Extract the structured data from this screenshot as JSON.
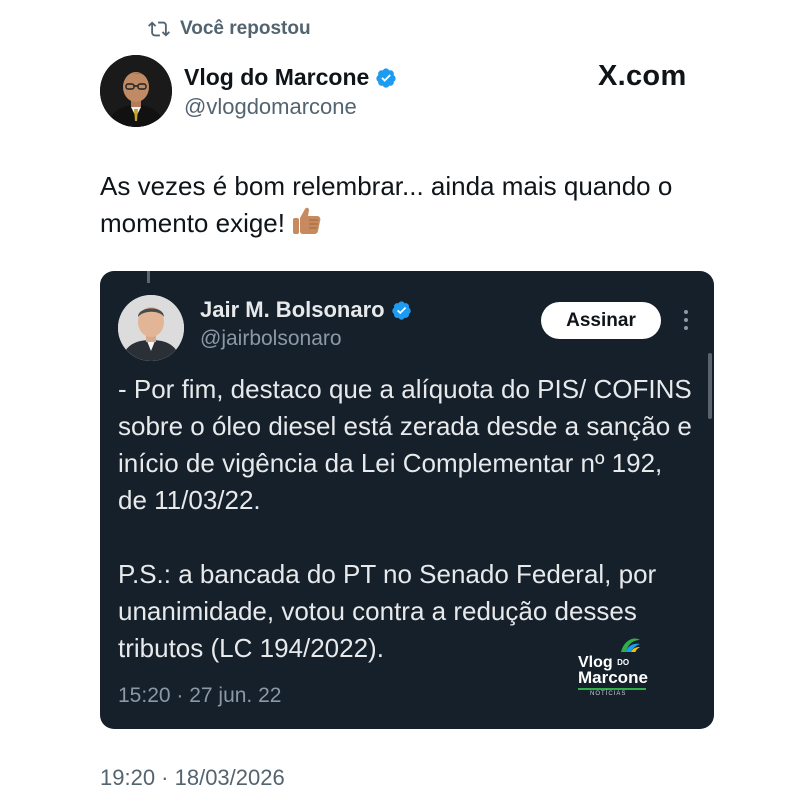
{
  "repost": {
    "label": "Você repostou",
    "icon": "repost-icon"
  },
  "author": {
    "name": "Vlog do Marcone",
    "handle": "@vlogdomarcone",
    "verified": true,
    "verified_color": "#1d9bf0",
    "avatar": "man-with-glasses-avatar"
  },
  "branding": {
    "label": "X.com"
  },
  "post": {
    "text": "As vezes é bom relembrar... ainda mais quando o momento exige!",
    "emoji": "👍🏽",
    "timestamp": "19:20 · 18/03/2026"
  },
  "quote": {
    "author": {
      "name": "Jair M. Bolsonaro",
      "handle": "@jairbolsonaro",
      "verified": true,
      "avatar": "man-in-suit-avatar"
    },
    "subscribe_label": "Assinar",
    "more_icon": "more-vertical-icon",
    "paragraph1": "- Por fim, destaco que a alíquota do PIS/ COFINS sobre o óleo diesel está zerada desde a sanção e início de vigência da Lei Complementar nº 192, de 11/03/22.",
    "paragraph2": "P.S.: a bancada do PT no Senado Federal, por unanimidade, votou contra a redução desses tributos (LC 194/2022).",
    "time": "15:20 · 27 jun. 22",
    "background": "#15202b"
  },
  "watermark": {
    "line1": "Vlog",
    "line1_small": "DO",
    "line2": "Marcone",
    "line3": "NOTÍCIAS"
  }
}
